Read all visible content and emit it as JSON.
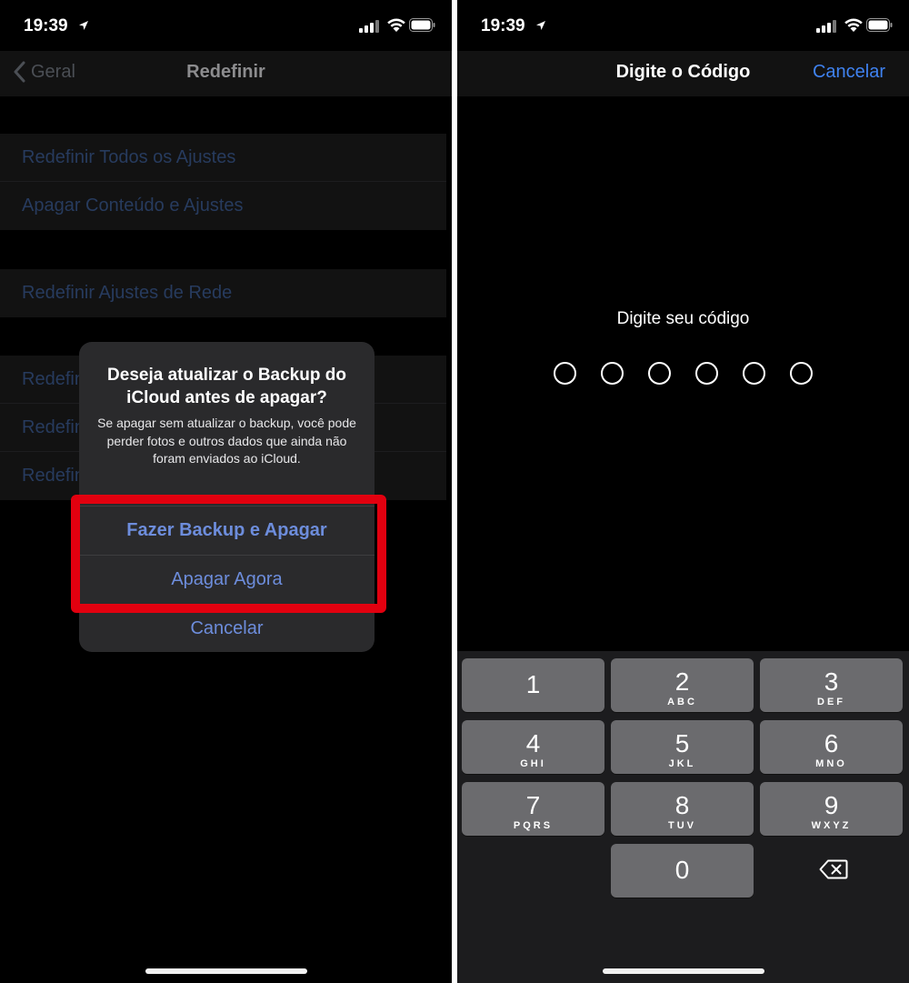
{
  "left": {
    "status": {
      "time": "19:39"
    },
    "navbar": {
      "back_label": "Geral",
      "title": "Redefinir"
    },
    "groups": [
      [
        "Redefinir Todos os Ajustes",
        "Apagar Conteúdo e Ajustes"
      ],
      [
        "Redefinir Ajustes de Rede"
      ],
      [
        "Redefinir",
        "Redefinir",
        "Redefinir"
      ]
    ],
    "alert": {
      "title": "Deseja atualizar o Backup do iCloud antes de apagar?",
      "message": "Se apagar sem atualizar o backup, você pode perder fotos e outros dados que ainda não foram enviados ao iCloud.",
      "buttons": [
        "Fazer Backup e Apagar",
        "Apagar Agora",
        "Cancelar"
      ]
    },
    "colors": {
      "highlight": "#e2000f",
      "link": "#3f82f0"
    }
  },
  "right": {
    "status": {
      "time": "19:39"
    },
    "navbar": {
      "title": "Digite o Código",
      "cancel_label": "Cancelar"
    },
    "prompt": "Digite seu código",
    "passcode_length": 6,
    "keys": [
      {
        "digit": "1",
        "letters": ""
      },
      {
        "digit": "2",
        "letters": "ABC"
      },
      {
        "digit": "3",
        "letters": "DEF"
      },
      {
        "digit": "4",
        "letters": "GHI"
      },
      {
        "digit": "5",
        "letters": "JKL"
      },
      {
        "digit": "6",
        "letters": "MNO"
      },
      {
        "digit": "7",
        "letters": "PQRS"
      },
      {
        "digit": "8",
        "letters": "TUV"
      },
      {
        "digit": "9",
        "letters": "WXYZ"
      },
      {
        "digit": "0",
        "letters": ""
      }
    ],
    "delete_icon": "delete-backspace-icon"
  }
}
